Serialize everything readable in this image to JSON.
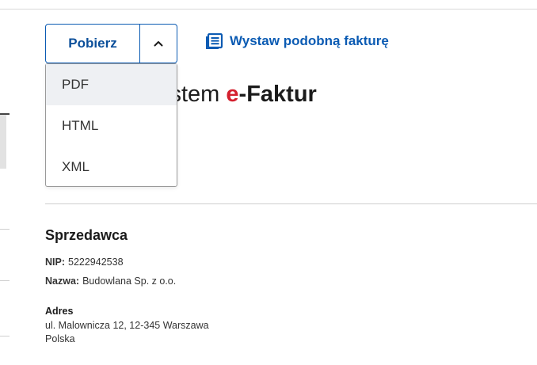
{
  "toolbar": {
    "download_label": "Pobierz",
    "similar_invoice_label": "Wystaw podobną fakturę"
  },
  "download_menu": {
    "items": [
      "PDF",
      "HTML",
      "XML"
    ],
    "active_index": 0
  },
  "header": {
    "title_prefix": "ystem ",
    "title_e": "e",
    "title_suffix": "-Faktur"
  },
  "seller": {
    "section_title": "Sprzedawca",
    "nip_label": "NIP:",
    "nip_value": "5222942538",
    "name_label": "Nazwa:",
    "name_value": "Budowlana Sp. z o.o.",
    "address_title": "Adres",
    "address_line1": "ul. Malownicza 12, 12-345 Warszawa",
    "address_line2": "Polska"
  },
  "colors": {
    "accent": "#0b5bb3",
    "brand_red": "#d4202e"
  },
  "icons": {
    "toggle": "chevron-up-icon",
    "similar": "document-list-icon"
  }
}
